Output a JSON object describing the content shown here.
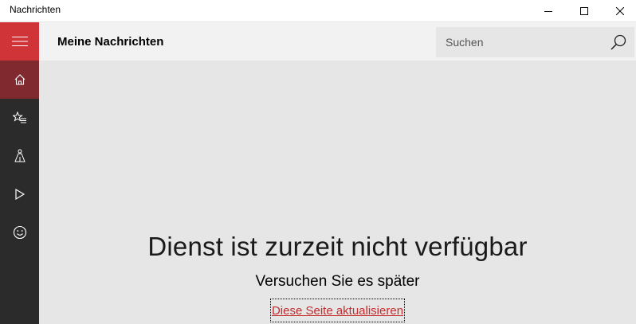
{
  "window": {
    "title": "Nachrichten"
  },
  "header": {
    "page_title": "Meine Nachrichten",
    "search_placeholder": "Suchen"
  },
  "nav": {
    "items": [
      {
        "icon": "hamburger-menu-icon"
      },
      {
        "icon": "home-icon",
        "selected": true
      },
      {
        "icon": "favorites-icon"
      },
      {
        "icon": "local-news-icon"
      },
      {
        "icon": "video-icon"
      },
      {
        "icon": "feedback-smiley-icon"
      }
    ]
  },
  "main": {
    "error_title": "Dienst ist zurzeit nicht verfügbar",
    "error_subtitle": "Versuchen Sie es später",
    "refresh_link": "Diese Seite aktualisieren"
  },
  "colors": {
    "accent": "#d13438",
    "selected_nav": "#802a2f",
    "rail": "#2b2b2b",
    "link": "#c42b2b"
  }
}
